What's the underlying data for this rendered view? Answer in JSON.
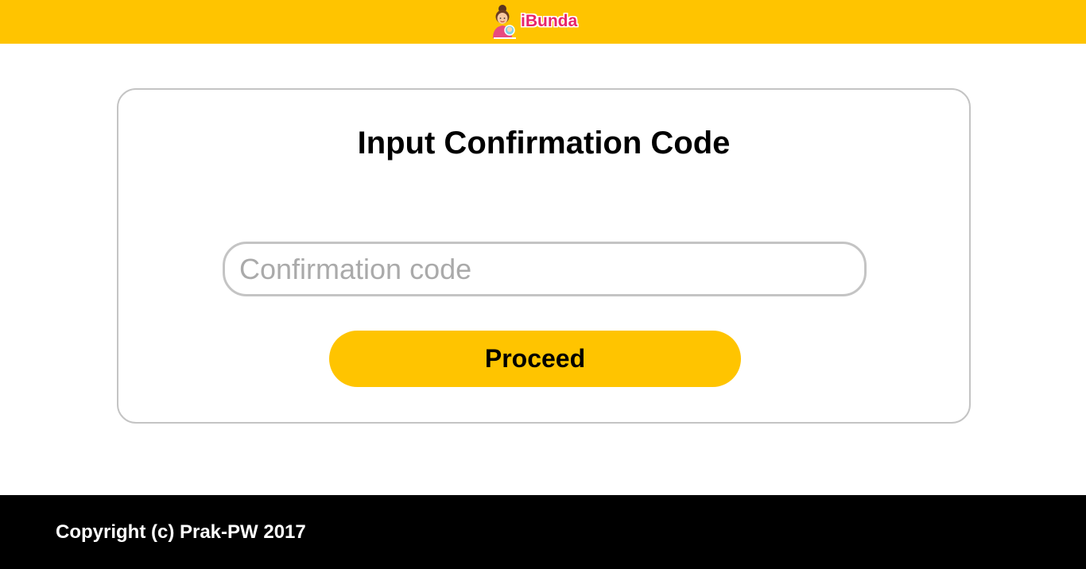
{
  "header": {
    "brand_name": "iBunda",
    "background_color": "#ffc400",
    "brand_color": "#e8246a",
    "logo_icon": "mother-with-child-icon"
  },
  "main": {
    "title": "Input Confirmation Code",
    "code_input": {
      "placeholder": "Confirmation code",
      "value": ""
    },
    "proceed_label": "Proceed",
    "accent_color": "#ffc400"
  },
  "footer": {
    "copyright": "Copyright (c) Prak-PW 2017"
  }
}
